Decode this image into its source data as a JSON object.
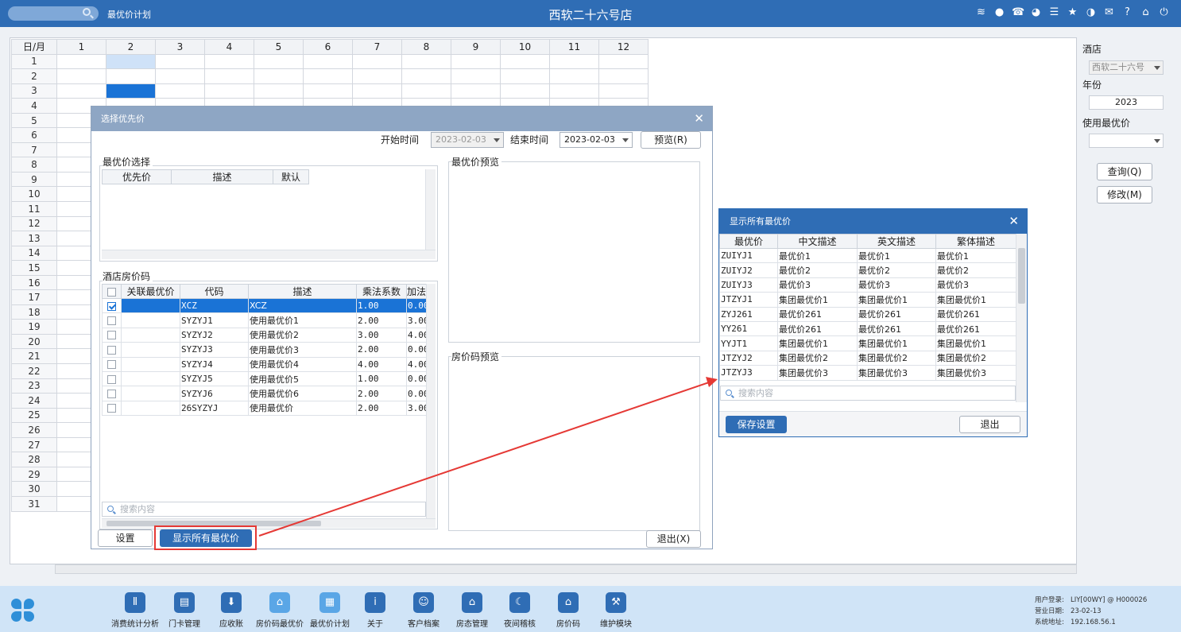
{
  "topbar": {
    "app_title": "最优价计划",
    "hotel_title": "西软二十六号店",
    "icons": [
      "wifi-icon",
      "chat-icon",
      "phone-icon",
      "palette-icon",
      "menu-icon",
      "star-icon",
      "theme-icon",
      "mail-icon",
      "help-icon",
      "home-icon",
      "power-icon"
    ]
  },
  "grid": {
    "corner": "日/月",
    "months": [
      "1",
      "2",
      "3",
      "4",
      "5",
      "6",
      "7",
      "8",
      "9",
      "10",
      "11",
      "12"
    ],
    "days": [
      "1",
      "2",
      "3",
      "4",
      "5",
      "6",
      "7",
      "8",
      "9",
      "10",
      "11",
      "12",
      "13",
      "14",
      "15",
      "16",
      "17",
      "18",
      "19",
      "20",
      "21",
      "22",
      "23",
      "24",
      "25",
      "26",
      "27",
      "28",
      "29",
      "30",
      "31"
    ]
  },
  "sidepanel": {
    "hotel_label": "酒店",
    "hotel_value": "西软二十六号",
    "year_label": "年份",
    "year_value": "2023",
    "best_label": "使用最优价",
    "best_value": "",
    "query_btn": "查询(Q)",
    "modify_btn": "修改(M)"
  },
  "dialog1": {
    "title": "选择优先价",
    "start_label": "开始时间",
    "start_value": "2023-02-03",
    "end_label": "结束时间",
    "end_value": "2023-02-03",
    "preview_btn": "预览(R)",
    "best_section": "最优价选择",
    "best_headers": [
      "优先价",
      "描述",
      "默认"
    ],
    "best_preview_section": "最优价预览",
    "ratecode_section": "酒店房价码",
    "ratecode_preview_section": "房价码预览",
    "rate_headers": [
      "关联最优价",
      "代码",
      "描述",
      "乘法系数",
      "加法"
    ],
    "rate_rows": [
      {
        "checked": true,
        "code": "XCZ",
        "desc": "XCZ",
        "mult": "1.00",
        "add": "0.00"
      },
      {
        "checked": false,
        "code": "SYZYJ1",
        "desc": "使用最优价1",
        "mult": "2.00",
        "add": "3.00"
      },
      {
        "checked": false,
        "code": "SYZYJ2",
        "desc": "使用最优价2",
        "mult": "3.00",
        "add": "4.00"
      },
      {
        "checked": false,
        "code": "SYZYJ3",
        "desc": "使用最优价3",
        "mult": "2.00",
        "add": "0.00"
      },
      {
        "checked": false,
        "code": "SYZYJ4",
        "desc": "使用最优价4",
        "mult": "4.00",
        "add": "4.00"
      },
      {
        "checked": false,
        "code": "SYZYJ5",
        "desc": "使用最优价5",
        "mult": "1.00",
        "add": "0.00"
      },
      {
        "checked": false,
        "code": "SYZYJ6",
        "desc": "使用最优价6",
        "mult": "2.00",
        "add": "0.00"
      },
      {
        "checked": false,
        "code": "26SYZYJ",
        "desc": "使用最优价",
        "mult": "2.00",
        "add": "3.00"
      }
    ],
    "search_placeholder": "搜索内容",
    "settings_btn": "设置",
    "show_all_btn": "显示所有最优价",
    "exit_btn": "退出(X)"
  },
  "dialog2": {
    "title": "显示所有最优价",
    "headers": [
      "最优价",
      "中文描述",
      "英文描述",
      "繁体描述"
    ],
    "rows": [
      [
        "ZUIYJ1",
        "最优价1",
        "最优价1",
        "最优价1"
      ],
      [
        "ZUIYJ2",
        "最优价2",
        "最优价2",
        "最优价2"
      ],
      [
        "ZUIYJ3",
        "最优价3",
        "最优价3",
        "最优价3"
      ],
      [
        "JTZYJ1",
        "集团最优价1",
        "集团最优价1",
        "集团最优价1"
      ],
      [
        "ZYJ261",
        "最优价261",
        "最优价261",
        "最优价261"
      ],
      [
        "YY261",
        "最优价261",
        "最优价261",
        "最优价261"
      ],
      [
        "YYJT1",
        "集团最优价1",
        "集团最优价1",
        "集团最优价1"
      ],
      [
        "JTZYJ2",
        "集团最优价2",
        "集团最优价2",
        "集团最优价2"
      ],
      [
        "JTZYJ3",
        "集团最优价3",
        "集团最优价3",
        "集团最优价3"
      ]
    ],
    "search_placeholder": "搜索内容",
    "save_btn": "保存设置",
    "exit_btn": "退出"
  },
  "dock": {
    "items": [
      {
        "label": "消费统计分析",
        "icon": "bar-chart-icon"
      },
      {
        "label": "门卡管理",
        "icon": "card-icon"
      },
      {
        "label": "应收账",
        "icon": "download-icon"
      },
      {
        "label": "房价码最优价",
        "icon": "house-price-icon"
      },
      {
        "label": "最优价计划",
        "icon": "calendar-icon"
      },
      {
        "label": "关于",
        "icon": "info-icon"
      },
      {
        "label": "客户档案",
        "icon": "profile-icon"
      },
      {
        "label": "房态管理",
        "icon": "house-icon"
      },
      {
        "label": "夜间稽核",
        "icon": "moon-icon"
      },
      {
        "label": "房价码",
        "icon": "home-icon"
      },
      {
        "label": "维护模块",
        "icon": "wrench-icon"
      }
    ],
    "info": {
      "user_label": "用户登录:",
      "user_value": "LIY[00WY] @ H000026",
      "date_label": "营业日期:",
      "date_value": "23-02-13",
      "addr_label": "系统地址:",
      "addr_value": "192.168.56.1"
    }
  },
  "colors": {
    "topbar": "#2f6db5",
    "selection": "#1a73d6",
    "annotation": "#e53935"
  }
}
